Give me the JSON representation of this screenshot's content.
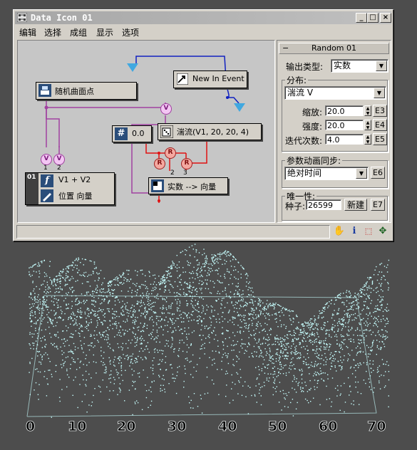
{
  "window": {
    "title": "Data Icon 01",
    "buttons": {
      "minimize": "_",
      "maximize": "□",
      "close": "×"
    }
  },
  "menu": [
    "编辑",
    "选择",
    "成组",
    "显示",
    "选项"
  ],
  "graph": {
    "nodes": {
      "surface_points": "随机曲面点",
      "new_in_event": "New In Event",
      "turbulence": "湍流(V1, 20, 20, 4)",
      "constant": "0.0",
      "expression_num": "01",
      "expression": "V1 + V2",
      "expression_sub": "位置 向量",
      "real_to_vector": "实数 --> 向量"
    },
    "port_labels": {
      "v": "V",
      "r": "R",
      "expr_in1": "1",
      "expr_in2": "2",
      "rtv_in2": "2",
      "rtv_in3": "3"
    },
    "icons": {
      "constant_icon": "#",
      "expression_icon": "f"
    }
  },
  "panel": {
    "rollout_title": "Random 01",
    "rollout_toggle": "−",
    "output_type_label": "输出类型:",
    "output_type_value": "实数",
    "distribution_label": "分布:",
    "distribution_value": "湍流 V",
    "scale_label": "缩放:",
    "scale_value": "20.0",
    "scale_btn": "E3",
    "strength_label": "强度:",
    "strength_value": "20.0",
    "strength_btn": "E4",
    "iterations_label": "迭代次数:",
    "iterations_value": "4.0",
    "iterations_btn": "E5",
    "sync_label": "参数动画同步:",
    "sync_value": "绝对时间",
    "sync_btn": "E6",
    "unique_label": "唯一性:",
    "seed_label": "种子:",
    "seed_value": "26599",
    "new_btn": "新建",
    "seed_btn": "E7"
  },
  "viewport": {
    "axis_labels": [
      "0",
      "10",
      "20",
      "30",
      "40",
      "50",
      "60",
      "70"
    ],
    "particle_color": "#c8ffff"
  },
  "colors": {
    "wire_purple": "#a040a0",
    "wire_red": "#e01010",
    "wire_blue": "#1020c0",
    "titlebar": "#b0b0b0"
  }
}
